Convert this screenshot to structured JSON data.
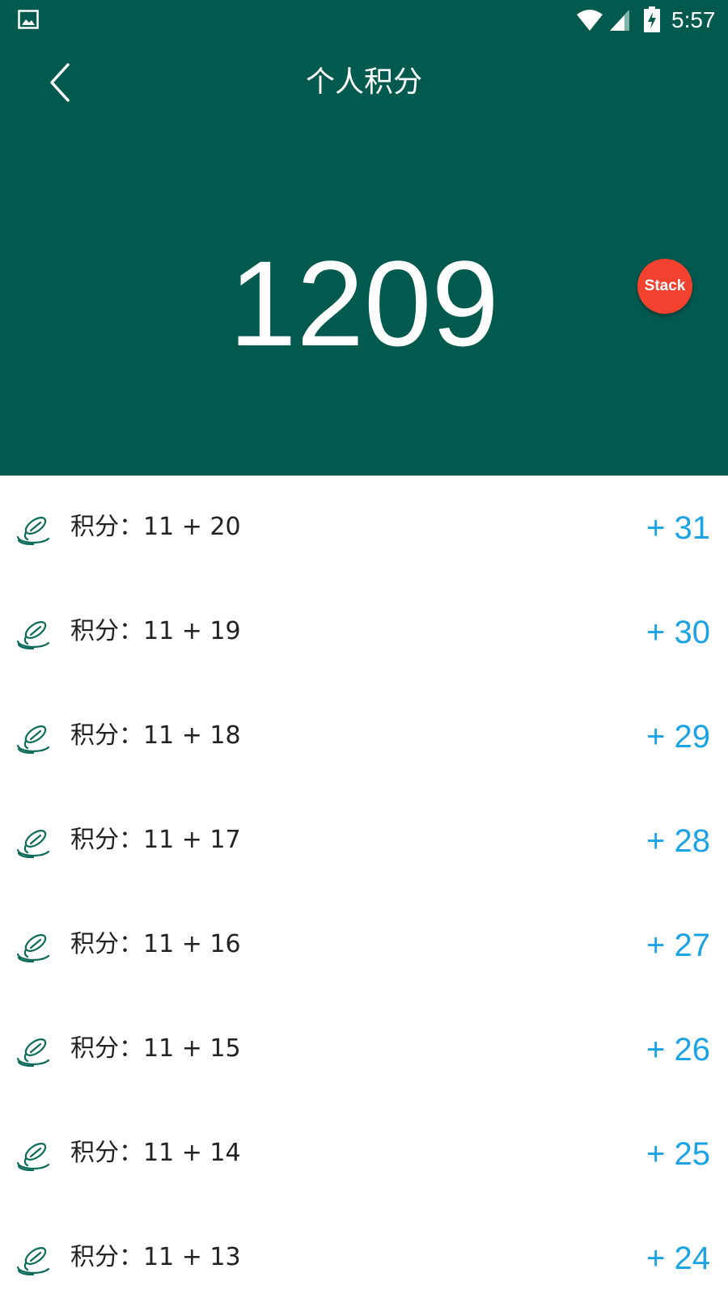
{
  "status_bar": {
    "time": "5:57",
    "icons": [
      "gallery-icon",
      "wifi-icon",
      "signal-icon",
      "battery-charging-icon"
    ]
  },
  "toolbar": {
    "title": "个人积分",
    "back_icon": "chevron-left-icon"
  },
  "score": {
    "total": "1209"
  },
  "stack_button": {
    "label": "Stack"
  },
  "colors": {
    "header_bg": "#025a4f",
    "accent_red": "#f2412e",
    "value_blue": "#1ba3e6",
    "icon_green": "#0c6b5a"
  },
  "points_list": [
    {
      "label": "积分：11 + 20",
      "value": "+ 31",
      "icon": "coins-icon"
    },
    {
      "label": "积分：11 + 19",
      "value": "+ 30",
      "icon": "coins-icon"
    },
    {
      "label": "积分：11 + 18",
      "value": "+ 29",
      "icon": "coins-icon"
    },
    {
      "label": "积分：11 + 17",
      "value": "+ 28",
      "icon": "coins-icon"
    },
    {
      "label": "积分：11 + 16",
      "value": "+ 27",
      "icon": "coins-icon"
    },
    {
      "label": "积分：11 + 15",
      "value": "+ 26",
      "icon": "coins-icon"
    },
    {
      "label": "积分：11 + 14",
      "value": "+ 25",
      "icon": "coins-icon"
    },
    {
      "label": "积分：11 + 13",
      "value": "+ 24",
      "icon": "coins-icon"
    }
  ]
}
